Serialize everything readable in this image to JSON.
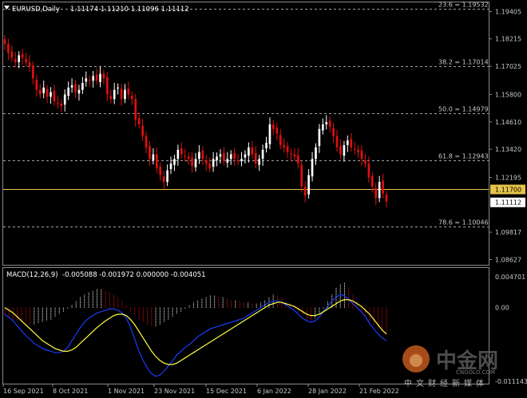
{
  "header": {
    "symbol_tf": "EURUSD,Daily",
    "ohlc": "1.11174 1.11210 1.11096 1.11112",
    "menu_icon": "dropdown-triangle-icon"
  },
  "macd": {
    "label": "MACD(12,26,9)",
    "values": "-0.005088 -0.001972 0.000000 -0.004051"
  },
  "watermark": {
    "brand": "中金网",
    "domain": "CNGOLD.COM",
    "slogan": "中文财经新媒体"
  },
  "colors": {
    "bull": "#ffffff",
    "bear": "#e01010",
    "grid": "#7a7a7a",
    "fib": "#a0a0a0",
    "hline": "#e6c34a",
    "macd_up": "#ffffff",
    "macd_down": "#e01010",
    "signal": "#ffff40",
    "main": "#1a3cff"
  },
  "chart_data": [
    {
      "type": "candlestick",
      "title": "EURUSD,Daily",
      "ylim": [
        1.084,
        1.198
      ],
      "y_ticks": [
        "1.19405",
        "1.18215",
        "1.17025",
        "1.15800",
        "1.14610",
        "1.13420",
        "1.12195",
        "1.09817",
        "1.08627"
      ],
      "x_ticks": [
        "16 Sep 2021",
        "8 Oct 2021",
        "1 Nov 2021",
        "23 Nov 2021",
        "15 Dec 2021",
        "6 Jan 2022",
        "28 Jan 2022",
        "21 Feb 2022"
      ],
      "fib_levels": [
        {
          "label": "23.6 = 1.19532",
          "value": 1.19532
        },
        {
          "label": "38.2 = 1.17014",
          "value": 1.17014
        },
        {
          "label": "50.0 = 1.14979",
          "value": 1.14979
        },
        {
          "label": "61.8 = 1.12943",
          "value": 1.12943
        },
        {
          "label": "78.6 = 1.10046",
          "value": 1.10046
        }
      ],
      "horizontal_line": {
        "label": "1.11700",
        "value": 1.117
      },
      "current_price": {
        "label": "1.11112",
        "value": 1.11112
      },
      "close": [
        1.18,
        1.176,
        1.174,
        1.172,
        1.175,
        1.174,
        1.172,
        1.17,
        1.165,
        1.16,
        1.158,
        1.161,
        1.157,
        1.159,
        1.155,
        1.154,
        1.153,
        1.158,
        1.161,
        1.162,
        1.159,
        1.16,
        1.163,
        1.165,
        1.164,
        1.166,
        1.164,
        1.167,
        1.165,
        1.158,
        1.156,
        1.16,
        1.161,
        1.156,
        1.16,
        1.158,
        1.156,
        1.147,
        1.145,
        1.14,
        1.135,
        1.13,
        1.132,
        1.126,
        1.123,
        1.12,
        1.125,
        1.128,
        1.13,
        1.134,
        1.132,
        1.131,
        1.13,
        1.127,
        1.13,
        1.133,
        1.13,
        1.128,
        1.126,
        1.13,
        1.131,
        1.132,
        1.129,
        1.13,
        1.132,
        1.13,
        1.129,
        1.13,
        1.132,
        1.135,
        1.132,
        1.128,
        1.13,
        1.134,
        1.137,
        1.145,
        1.143,
        1.141,
        1.136,
        1.135,
        1.133,
        1.132,
        1.131,
        1.128,
        1.118,
        1.114,
        1.123,
        1.13,
        1.135,
        1.143,
        1.145,
        1.146,
        1.144,
        1.14,
        1.135,
        1.132,
        1.136,
        1.138,
        1.135,
        1.134,
        1.133,
        1.13,
        1.128,
        1.122,
        1.118,
        1.113,
        1.12,
        1.115,
        1.1115
      ]
    },
    {
      "type": "bar",
      "title": "MACD(12,26,9)",
      "ylim": [
        -0.0115,
        0.006
      ],
      "y_ticks": [
        "0.004701",
        "0.00",
        "-0.011143"
      ],
      "series": [
        {
          "name": "MACD",
          "values": [
            -0.001,
            -0.0015,
            -0.002,
            -0.0028,
            -0.0035,
            -0.0042,
            -0.0048,
            -0.0054,
            -0.0058,
            -0.0062,
            -0.0064,
            -0.0066,
            -0.0068,
            -0.0068,
            -0.0066,
            -0.006,
            -0.005,
            -0.004,
            -0.003,
            -0.0022,
            -0.0016,
            -0.0012,
            -0.0008,
            -0.0006,
            -0.0004,
            -0.0002,
            -0.0002,
            -0.0004,
            -0.0008,
            -0.0016,
            -0.003,
            -0.0048,
            -0.0066,
            -0.008,
            -0.0092,
            -0.01,
            -0.0104,
            -0.0102,
            -0.0096,
            -0.0088,
            -0.008,
            -0.0072,
            -0.0066,
            -0.006,
            -0.0056,
            -0.005,
            -0.0044,
            -0.004,
            -0.0036,
            -0.0032,
            -0.003,
            -0.0028,
            -0.0026,
            -0.0024,
            -0.0022,
            -0.002,
            -0.0018,
            -0.0016,
            -0.0012,
            -0.0008,
            -0.0004,
            0.0,
            0.0004,
            0.0008,
            0.001,
            0.001,
            0.0008,
            0.0004,
            0.0,
            -0.0004,
            -0.001,
            -0.0016,
            -0.002,
            -0.0022,
            -0.002,
            -0.0014,
            -0.0006,
            0.0002,
            0.001,
            0.0016,
            0.002,
            0.0018,
            0.0012,
            0.0006,
            0.0,
            -0.0006,
            -0.0014,
            -0.0024,
            -0.0032,
            -0.004,
            -0.0046,
            -0.005
          ]
        },
        {
          "name": "Signal",
          "values": [
            0.0,
            -0.0004,
            -0.0008,
            -0.0014,
            -0.002,
            -0.0026,
            -0.0032,
            -0.0038,
            -0.0044,
            -0.005,
            -0.0054,
            -0.0058,
            -0.0062,
            -0.0064,
            -0.0066,
            -0.0066,
            -0.0064,
            -0.006,
            -0.0054,
            -0.0048,
            -0.0042,
            -0.0036,
            -0.003,
            -0.0025,
            -0.002,
            -0.0016,
            -0.0012,
            -0.001,
            -0.001,
            -0.0012,
            -0.0018,
            -0.0026,
            -0.0036,
            -0.0046,
            -0.0056,
            -0.0066,
            -0.0074,
            -0.008,
            -0.0084,
            -0.0086,
            -0.0086,
            -0.0084,
            -0.008,
            -0.0076,
            -0.0072,
            -0.0068,
            -0.0064,
            -0.006,
            -0.0056,
            -0.0052,
            -0.0048,
            -0.0044,
            -0.004,
            -0.0036,
            -0.0032,
            -0.0028,
            -0.0024,
            -0.002,
            -0.0016,
            -0.0012,
            -0.0008,
            -0.0004,
            0.0,
            0.0004,
            0.0006,
            0.0008,
            0.0008,
            0.0006,
            0.0004,
            0.0002,
            -0.0002,
            -0.0006,
            -0.001,
            -0.0012,
            -0.0012,
            -0.001,
            -0.0006,
            -0.0002,
            0.0002,
            0.0006,
            0.001,
            0.0012,
            0.0012,
            0.001,
            0.0006,
            0.0002,
            -0.0004,
            -0.001,
            -0.0018,
            -0.0026,
            -0.0034,
            -0.004
          ]
        },
        {
          "name": "Histogram",
          "values": [
            -0.0012,
            -0.0016,
            -0.0018,
            -0.002,
            -0.0022,
            -0.0024,
            -0.0026,
            -0.0026,
            -0.0024,
            -0.0022,
            -0.002,
            -0.0018,
            -0.0014,
            -0.001,
            -0.0006,
            -0.0002,
            0.0004,
            0.001,
            0.0016,
            0.002,
            0.0024,
            0.0026,
            0.0028,
            0.0028,
            0.0026,
            0.0024,
            0.002,
            0.0016,
            0.001,
            0.0004,
            -0.0006,
            -0.0012,
            -0.0018,
            -0.0022,
            -0.0026,
            -0.0028,
            -0.0028,
            -0.0026,
            -0.0022,
            -0.0018,
            -0.0014,
            -0.001,
            -0.0006,
            -0.0002,
            0.0004,
            0.0008,
            0.0012,
            0.0014,
            0.0016,
            0.0018,
            0.0018,
            0.0016,
            0.0016,
            0.0014,
            0.0012,
            0.0012,
            0.001,
            0.0008,
            0.0008,
            0.0006,
            0.0006,
            0.0008,
            0.0012,
            0.0016,
            0.002,
            0.0018,
            0.0014,
            0.001,
            0.0006,
            0.0002,
            -0.0006,
            -0.0012,
            -0.0018,
            -0.002,
            -0.0016,
            -0.001,
            -0.0002,
            0.001,
            0.002,
            0.003,
            0.0036,
            0.0038,
            0.003,
            0.002,
            0.001,
            -0.0006,
            -0.0014,
            -0.002,
            -0.0026,
            -0.0032,
            -0.0036,
            -0.004
          ]
        }
      ]
    }
  ]
}
